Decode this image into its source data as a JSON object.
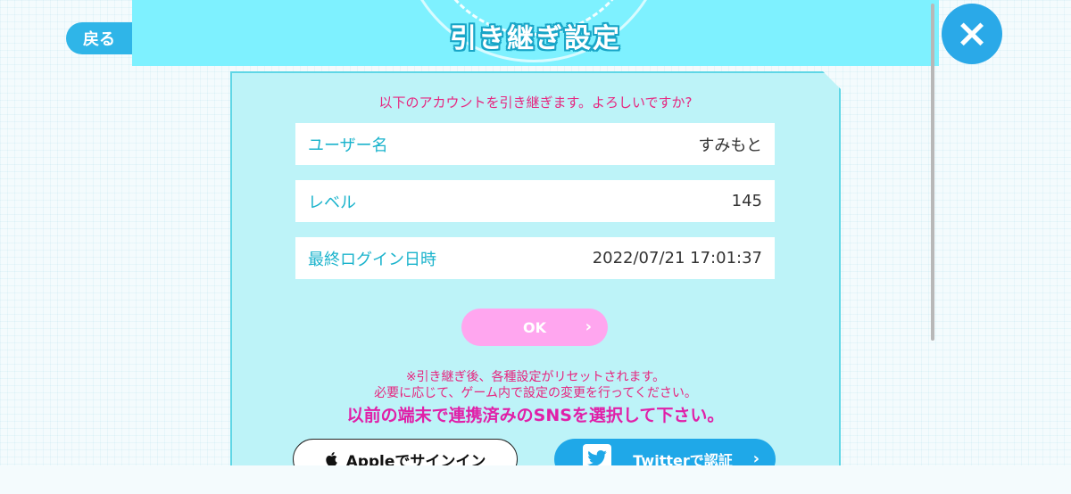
{
  "header": {
    "back_label": "戻る",
    "title": "引き継ぎ設定",
    "close_icon": "×"
  },
  "confirm": {
    "message": "以下のアカウントを引き継ぎます。よろしいですか?"
  },
  "account": [
    {
      "label": "ユーザー名",
      "value": "すみもと"
    },
    {
      "label": "レベル",
      "value": "145"
    },
    {
      "label": "最終ログイン日時",
      "value": "2022/07/21 17:01:37"
    }
  ],
  "ok_button": {
    "label": "OK",
    "chevron": "›"
  },
  "notes": {
    "line1": "※引き継ぎ後、各種設定がリセットされます。",
    "line2": "必要に応じて、ゲーム内で設定の変更を行ってください。",
    "line3": "以前の端末で連携済みのSNSを選択して下さい。"
  },
  "sns": {
    "apple_label": "Appleでサインイン",
    "twitter_label": "Twitterで認証",
    "chevron": "›"
  },
  "colors": {
    "header_band": "#7ef1ff",
    "accent_blue": "#2aa9e8",
    "pink_text": "#e6267f",
    "ok_button": "#ffa6ef",
    "twitter": "#1fa8e8"
  },
  "icons": {
    "close": "close-icon",
    "apple": "apple-icon",
    "twitter": "twitter-bird-icon",
    "chevron": "chevron-right-icon"
  }
}
